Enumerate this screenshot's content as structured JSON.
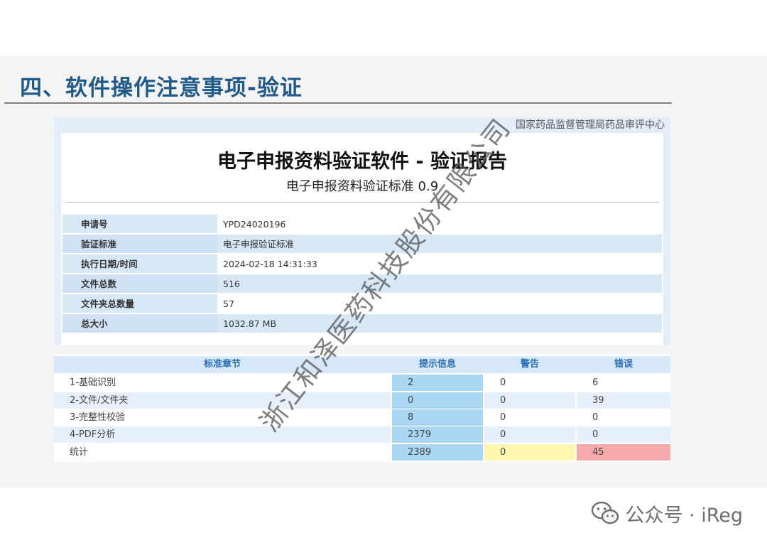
{
  "slide": {
    "title": "四、软件操作注意事项-验证"
  },
  "report": {
    "org": "国家药品监督管理局药品审评中心",
    "heading": "电子申报资料验证软件 - 验证报告",
    "subheading": "电子申报资料验证标准 0.9",
    "info": [
      {
        "label": "申请号",
        "value": "YPD24020196"
      },
      {
        "label": "验证标准",
        "value": "电子申报验证标准"
      },
      {
        "label": "执行日期/时间",
        "value": "2024-02-18 14:31:33"
      },
      {
        "label": "文件总数",
        "value": "516"
      },
      {
        "label": "文件夹总数量",
        "value": "57"
      },
      {
        "label": "总大小",
        "value": "1032.87 MB"
      }
    ]
  },
  "results": {
    "headers": [
      "标准章节",
      "提示信息",
      "警告",
      "错误"
    ],
    "rows": [
      {
        "section": "1-基础识别",
        "info": "2",
        "warning": "0",
        "error": "6"
      },
      {
        "section": "2-文件/文件夹",
        "info": "0",
        "warning": "0",
        "error": "39"
      },
      {
        "section": "3-完整性校验",
        "info": "8",
        "warning": "0",
        "error": "0"
      },
      {
        "section": "4-PDF分析",
        "info": "2379",
        "warning": "0",
        "error": "0"
      },
      {
        "section": "统计",
        "info": "2389",
        "warning": "0",
        "error": "45"
      }
    ]
  },
  "watermark": "浙江和泽医药科技股份有限公司",
  "footer": {
    "account": "公众号 · iReg",
    "icon": "wechat-icon"
  },
  "colors": {
    "title": "#1f5a8a",
    "header_text": "#2a6fb5",
    "info_highlight": "#a9d6f3",
    "warning_total": "#fdf7b0",
    "error_total": "#f6a9a9"
  }
}
